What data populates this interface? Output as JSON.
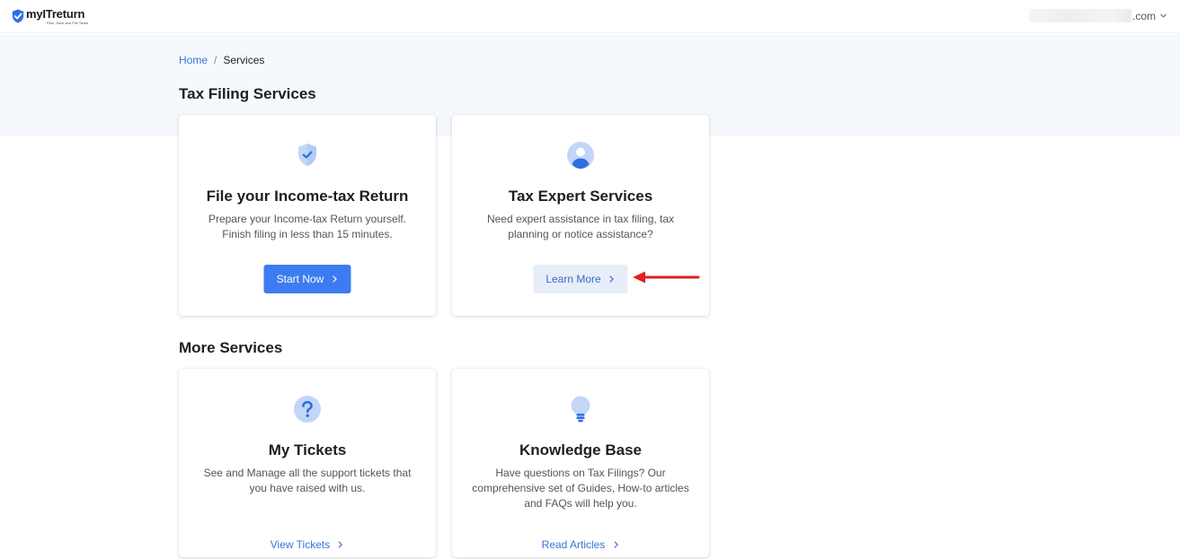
{
  "header": {
    "logo_name": "myITreturn",
    "logo_tagline": "Plan, Save and File Taxes",
    "account_suffix": ".com"
  },
  "breadcrumb": {
    "home": "Home",
    "separator": "/",
    "current": "Services"
  },
  "sections": {
    "tax_filing_title": "Tax Filing Services",
    "more_services_title": "More Services"
  },
  "cards": [
    {
      "icon": "shield-check-icon",
      "title": "File your Income-tax Return",
      "description": "Prepare your Income-tax Return yourself. Finish filing in less than 15 minutes.",
      "button_label": "Start Now"
    },
    {
      "icon": "user-avatar-icon",
      "title": "Tax Expert Services",
      "description": "Need expert assistance in tax filing, tax planning or notice assistance?",
      "button_label": "Learn More"
    },
    {
      "icon": "question-icon",
      "title": "My Tickets",
      "description": "See and Manage all the support tickets that you have raised with us.",
      "button_label": "View Tickets"
    },
    {
      "icon": "lightbulb-icon",
      "title": "Knowledge Base",
      "description": "Have questions on Tax Filings? Our comprehensive set of Guides, How-to articles and FAQs will help you.",
      "button_label": "Read Articles"
    }
  ],
  "colors": {
    "accent": "#3d7cf0",
    "link": "#3b74d6",
    "hero_bg": "#f5f8fd",
    "annotation_arrow": "#e02020"
  }
}
